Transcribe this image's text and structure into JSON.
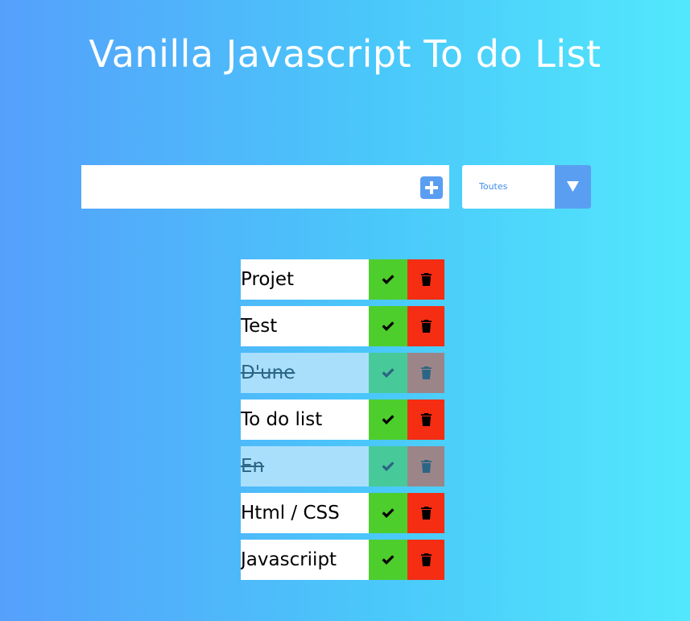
{
  "header": {
    "title": "Vanilla Javascript To do List"
  },
  "form": {
    "input_value": "",
    "add_icon": "plus-square-icon",
    "filter": {
      "selected": "Toutes",
      "arrow_icon": "triangle-down-icon"
    }
  },
  "todos": [
    {
      "text": "Projet",
      "completed": false
    },
    {
      "text": "Test",
      "completed": false
    },
    {
      "text": "D'une",
      "completed": true
    },
    {
      "text": "To do list",
      "completed": false
    },
    {
      "text": "En",
      "completed": true
    },
    {
      "text": "Html / CSS",
      "completed": false
    },
    {
      "text": "Javascriipt",
      "completed": false
    }
  ],
  "colors": {
    "gradient_start": "#55a0fb",
    "gradient_end": "#52e8fc",
    "accent": "#5a9ef2",
    "check": "#4ece2c",
    "trash": "#f42d13",
    "completed_bg": "#aadffc",
    "completed_check": "#48c999",
    "completed_trash": "#9c8589"
  },
  "icons": {
    "check": "check-icon",
    "trash": "trash-icon"
  }
}
